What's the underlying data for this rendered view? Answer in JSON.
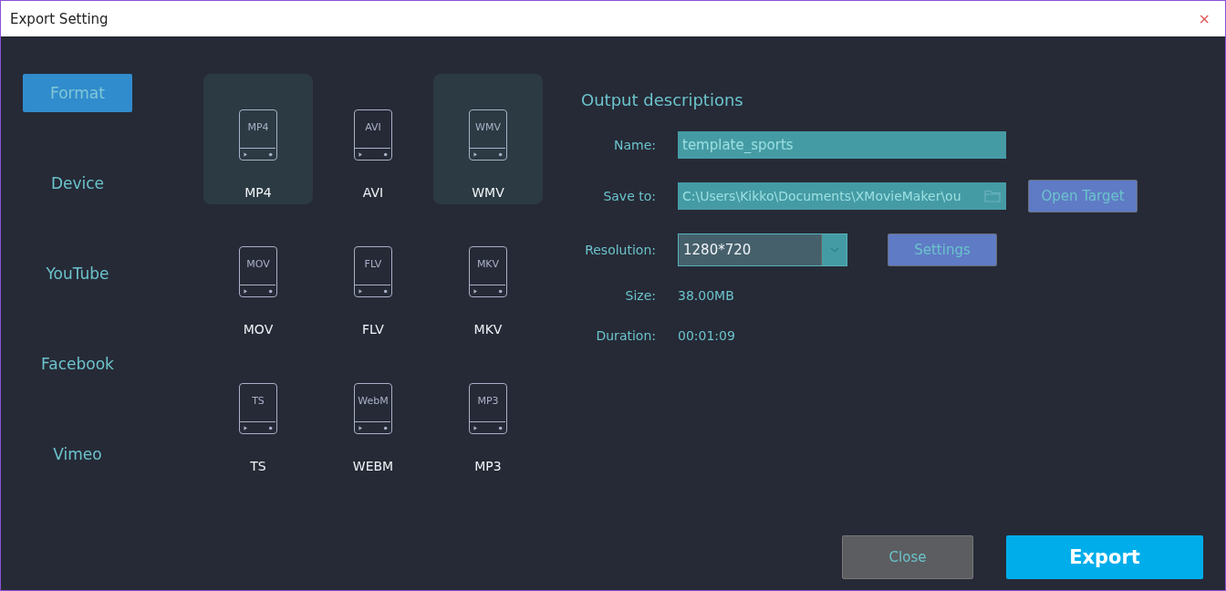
{
  "window": {
    "title": "Export Setting",
    "close": "×"
  },
  "sidebar": {
    "items": [
      {
        "label": "Format",
        "selected": true
      },
      {
        "label": "Device",
        "selected": false
      },
      {
        "label": "YouTube",
        "selected": false
      },
      {
        "label": "Facebook",
        "selected": false
      },
      {
        "label": "Vimeo",
        "selected": false
      }
    ]
  },
  "formats": [
    {
      "badge": "MP4",
      "label": "MP4",
      "selected": true
    },
    {
      "badge": "AVI",
      "label": "AVI",
      "selected": false
    },
    {
      "badge": "WMV",
      "label": "WMV",
      "selected": true
    },
    {
      "badge": "MOV",
      "label": "MOV",
      "selected": false
    },
    {
      "badge": "FLV",
      "label": "FLV",
      "selected": false
    },
    {
      "badge": "MKV",
      "label": "MKV",
      "selected": false
    },
    {
      "badge": "TS",
      "label": "TS",
      "selected": false
    },
    {
      "badge": "WebM",
      "label": "WEBM",
      "selected": false
    },
    {
      "badge": "MP3",
      "label": "MP3",
      "selected": false
    }
  ],
  "output": {
    "heading": "Output descriptions",
    "name": {
      "label": "Name:",
      "value": "template_sports"
    },
    "save_to": {
      "label": "Save to:",
      "value": "C:\\Users\\Kikko\\Documents\\XMovieMaker\\ou",
      "button": "Open Target"
    },
    "resolution": {
      "label": "Resolution:",
      "value": "1280*720",
      "button": "Settings"
    },
    "size": {
      "label": "Size:",
      "value": "38.00MB"
    },
    "duration": {
      "label": "Duration:",
      "value": "00:01:09"
    }
  },
  "buttons": {
    "close": "Close",
    "export": "Export"
  }
}
